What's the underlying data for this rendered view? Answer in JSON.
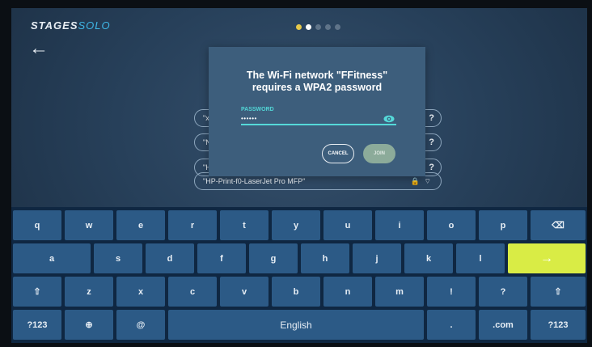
{
  "header": {
    "brand_part1": "STAGES",
    "brand_part2": "SOLO",
    "step_dots": 5,
    "back_glyph": "←"
  },
  "networks": [
    {
      "ssid_visible": "\"xf",
      "trailing": "?"
    },
    {
      "ssid_visible": "\"N",
      "trailing": "?"
    },
    {
      "ssid_visible": "\"H",
      "trailing": "?"
    },
    {
      "ssid_visible": "\"HP-Print-f0-LaserJet Pro MFP\"",
      "lock": "🔒",
      "wifi": "⌔"
    }
  ],
  "dialog": {
    "title_line1": "The Wi-Fi network \"FFitness\"",
    "title_line2": "requires a WPA2 password",
    "password_label": "PASSWORD",
    "password_value": "••••••",
    "cancel_label": "CANCEL",
    "join_label": "JOIN"
  },
  "keyboard": {
    "row1": [
      "q",
      "w",
      "e",
      "r",
      "t",
      "y",
      "u",
      "i",
      "o",
      "p",
      "⌫"
    ],
    "row2": [
      "a",
      "s",
      "d",
      "f",
      "g",
      "h",
      "j",
      "k",
      "l",
      "→"
    ],
    "row3": [
      "⇧",
      "z",
      "x",
      "c",
      "v",
      "b",
      "n",
      "m",
      "!",
      "?",
      "⇧"
    ],
    "row4": [
      "?123",
      "⊕",
      "@",
      "English",
      ".",
      ".com",
      "?123"
    ]
  },
  "colors": {
    "accent_teal": "#55d9d9",
    "enter_key": "#d9ec45",
    "key_bg": "#2c5a86",
    "dialog_bg": "#3d5e7c"
  }
}
